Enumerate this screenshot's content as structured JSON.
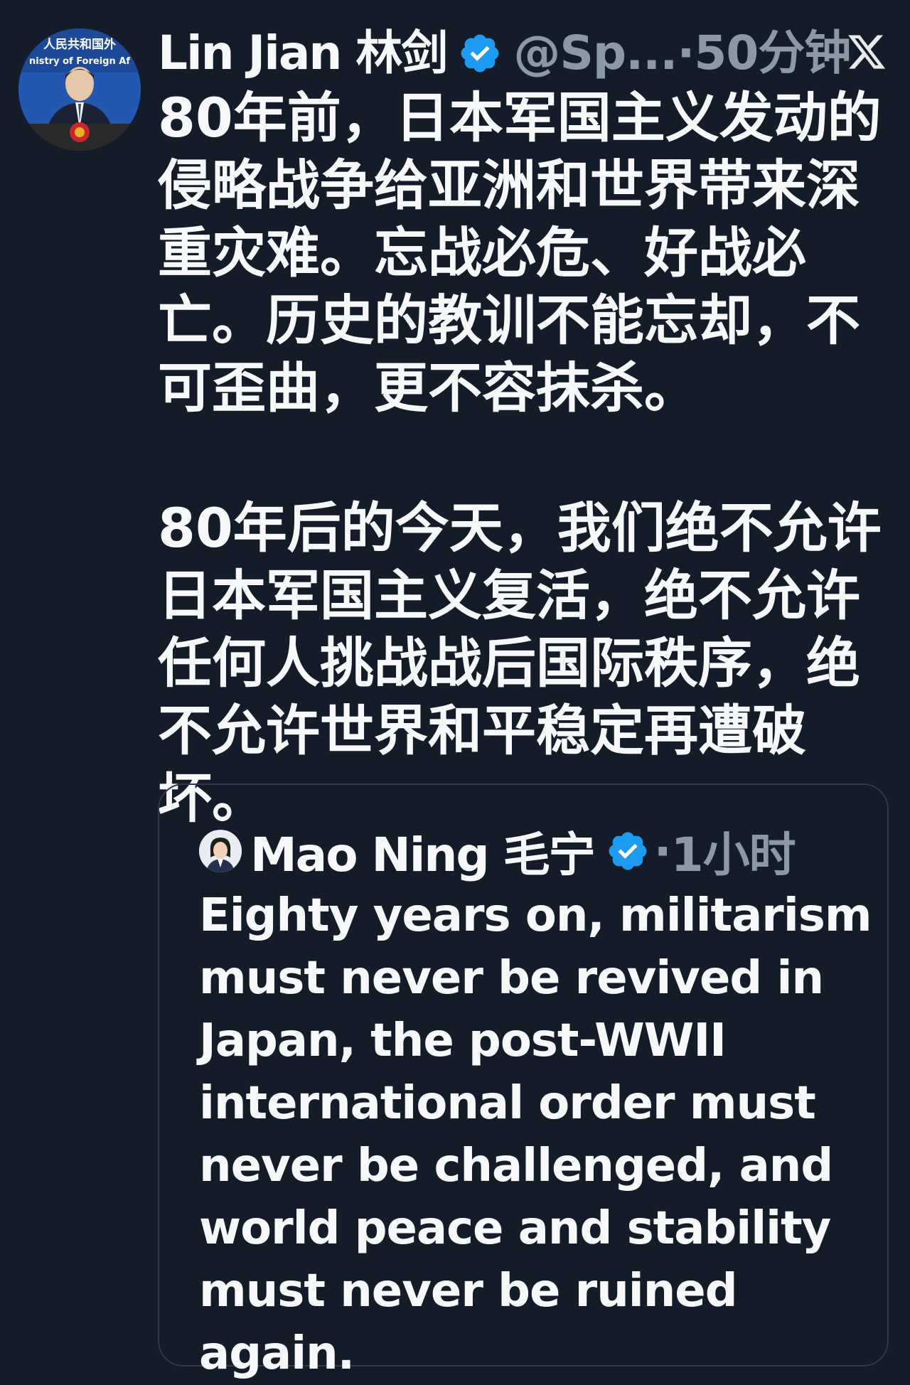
{
  "tweet": {
    "author": {
      "name": "Lin Jian 林剑",
      "handle": "@Sp...",
      "separator": "·",
      "time": "50分钟",
      "avatar_text_top": "人民共和国外",
      "avatar_text_bottom": "nistry of Foreign Af"
    },
    "paragraphs": [
      "80年前，日本军国主义发动的侵略战争给亚洲和世界带来深重灾难。忘战必危、好战必亡。历史的教训不能忘却，不可歪曲，更不容抹杀。",
      "80年后的今天，我们绝不允许日本军国主义复活，绝不允许任何人挑战战后国际秩序，绝不允许世界和平稳定再遭破坏。"
    ]
  },
  "quoted_tweet": {
    "author": {
      "name": "Mao Ning 毛宁",
      "separator": "·",
      "time": "1小时"
    },
    "text": "Eighty years on, militarism must never be revived in Japan, the post-WWII international order must never be challenged, and world peace and stability must never be ruined again."
  },
  "icons": {
    "verified": "verified-badge-icon",
    "x_logo": "x-logo-icon"
  },
  "colors": {
    "background": "#141c29",
    "text": "#f7f8f9",
    "muted": "#8b98a5",
    "verified_blue": "#1d9bf0",
    "border": "#2f3a48"
  }
}
